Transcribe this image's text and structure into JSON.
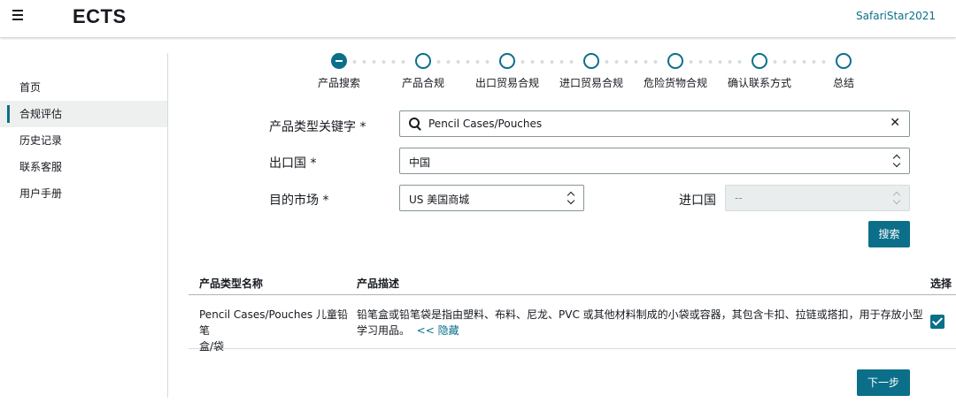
{
  "header": {
    "app_title": "ECTS",
    "username": "SafariStar2021"
  },
  "sidebar": {
    "items": [
      {
        "label": "首页"
      },
      {
        "label": "合规评估"
      },
      {
        "label": "历史记录"
      },
      {
        "label": "联系客服"
      },
      {
        "label": "用户手册"
      }
    ],
    "active_index": 1
  },
  "stepper": {
    "steps": [
      {
        "label": "产品搜索"
      },
      {
        "label": "产品合规"
      },
      {
        "label": "出口贸易合规"
      },
      {
        "label": "进口贸易合规"
      },
      {
        "label": "危险货物合规"
      },
      {
        "label": "确认联系方式"
      },
      {
        "label": "总结"
      }
    ],
    "current_index": 0
  },
  "form": {
    "keyword_label": "产品类型关键字 *",
    "keyword_value": "Pencil Cases/Pouches",
    "export_country_label": "出口国 *",
    "export_country_value": "中国",
    "market_label": "目的市场 *",
    "market_value": "US 美国商城",
    "import_country_label": "进口国",
    "import_country_value": "--",
    "search_button": "搜索"
  },
  "table": {
    "columns": [
      "产品类型名称",
      "产品描述",
      "选择"
    ],
    "rows": [
      {
        "name_line1": "Pencil Cases/Pouches 儿童铅笔",
        "name_line2": "盒/袋",
        "desc_line1": "铅笔盒或铅笔袋是指由塑料、布料、尼龙、PVC 或其他材料制成的小袋或容器，其包含卡扣、拉链或搭扣，用于存放小型",
        "desc_line2": "学习用品。",
        "toggle_link": "<< 隐藏",
        "selected": true
      }
    ]
  },
  "next_button": "下一步",
  "colors": {
    "accent": "#0b6f8a",
    "border": "#879596",
    "disabled_bg": "#eaeded"
  }
}
